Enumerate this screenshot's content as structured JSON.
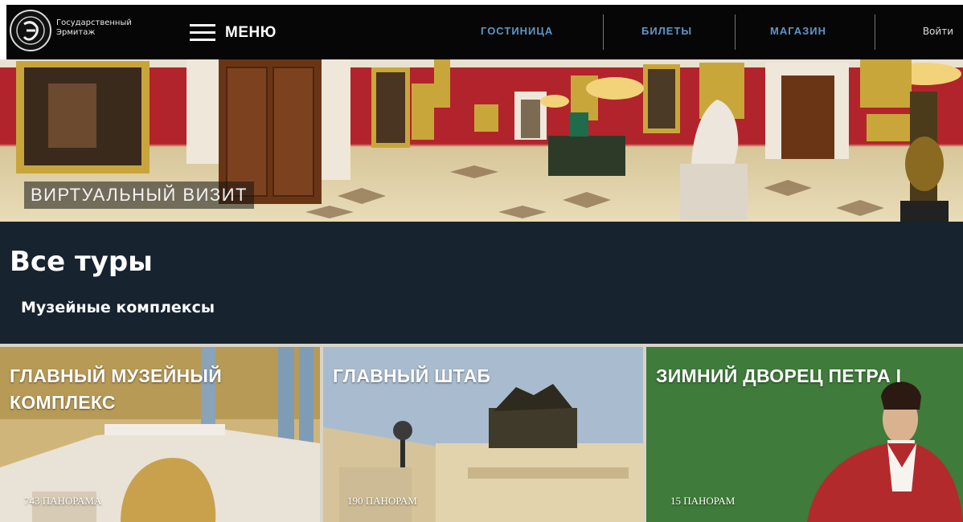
{
  "header": {
    "logo_text_line1": "Государственный",
    "logo_text_line2": "Эрмитаж",
    "menu_label": "МЕНЮ",
    "nav": [
      {
        "label": "ГОСТИНИЦА"
      },
      {
        "label": "БИЛЕТЫ"
      },
      {
        "label": "МАГАЗИН"
      }
    ],
    "login_label": "Войти"
  },
  "hero": {
    "label": "ВИРТУАЛЬНЫЙ ВИЗИТ"
  },
  "main": {
    "title": "Все туры",
    "section_title": "Музейные комплексы"
  },
  "cards": [
    {
      "title": "ГЛАВНЫЙ МУЗЕЙНЫЙ КОМПЛЕКС",
      "count": "743 ПАНОРАМА"
    },
    {
      "title": "ГЛАВНЫЙ ШТАБ",
      "count": "190 ПАНОРАМ"
    },
    {
      "title": "ЗИМНИЙ ДВОРЕЦ ПЕТРА I",
      "count": "15 ПАНОРАМ"
    }
  ],
  "colors": {
    "header_bg": "#060606",
    "nav_link": "#5f95c8",
    "band_bg": "#17232f",
    "hall_red": "#b2242c",
    "card3_bg": "#3f7b3a"
  },
  "icons": [
    "hermitage-logo-icon",
    "hamburger-menu-icon"
  ]
}
